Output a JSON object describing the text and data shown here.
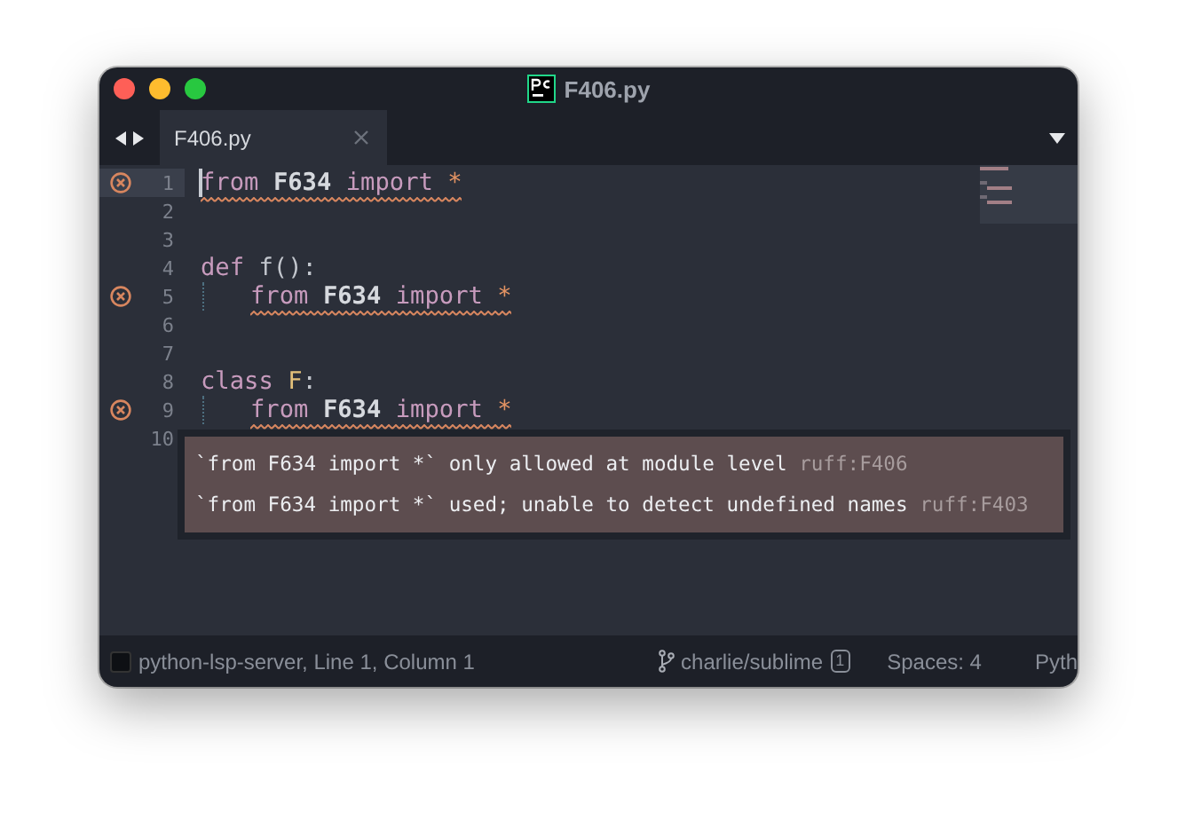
{
  "window": {
    "title": "F406.py"
  },
  "tabs": [
    {
      "label": "F406.py",
      "selected": true
    }
  ],
  "editor": {
    "lines": [
      {
        "number": "1",
        "error": true,
        "current": true,
        "indented": false,
        "flagged": true,
        "tokens": [
          {
            "kind": "keyword",
            "text": "from"
          },
          {
            "kind": "module",
            "text": "F634"
          },
          {
            "kind": "keyword",
            "text": "import"
          },
          {
            "kind": "operator",
            "text": "*"
          }
        ]
      },
      {
        "number": "2",
        "error": false,
        "current": false
      },
      {
        "number": "3",
        "error": false,
        "current": false
      },
      {
        "number": "4",
        "error": false,
        "current": false,
        "indented": false,
        "flagged": false,
        "tokens": [
          {
            "kind": "keyword",
            "text": "def"
          },
          {
            "kind": "name",
            "text": "f():"
          }
        ]
      },
      {
        "number": "5",
        "error": true,
        "current": false,
        "indented": true,
        "flagged": true,
        "tokens": [
          {
            "kind": "keyword",
            "text": "from"
          },
          {
            "kind": "module",
            "text": "F634"
          },
          {
            "kind": "keyword",
            "text": "import"
          },
          {
            "kind": "operator",
            "text": "*"
          }
        ]
      },
      {
        "number": "6",
        "error": false,
        "current": false
      },
      {
        "number": "7",
        "error": false,
        "current": false
      },
      {
        "number": "8",
        "error": false,
        "current": false,
        "indented": false,
        "flagged": false,
        "tokens": [
          {
            "kind": "keyword",
            "text": "class"
          },
          {
            "kind": "class_name",
            "text": "F"
          },
          {
            "kind": "punctuation",
            "text": ":"
          }
        ]
      },
      {
        "number": "9",
        "error": true,
        "current": false,
        "indented": true,
        "flagged": true,
        "tokens": [
          {
            "kind": "keyword",
            "text": "from"
          },
          {
            "kind": "module",
            "text": "F634"
          },
          {
            "kind": "keyword",
            "text": "import"
          },
          {
            "kind": "operator",
            "text": "*"
          }
        ]
      },
      {
        "number": "10",
        "error": false,
        "current": false
      }
    ]
  },
  "diagnostics": [
    {
      "message": "`from F634 import *` only allowed at module level",
      "source": "ruff:F406"
    },
    {
      "message": "`from F634 import *` used; unable to detect undefined names",
      "source": "ruff:F403"
    }
  ],
  "status_bar": {
    "server": "python-lsp-server, Line 1, Column 1",
    "branch": "charlie/sublime",
    "branch_badge": "1",
    "indentation": "Spaces: 4",
    "syntax": "Pyth"
  }
}
